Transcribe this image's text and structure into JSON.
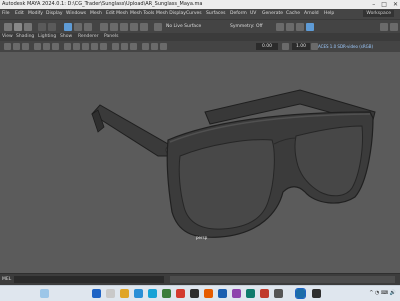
{
  "window": {
    "title": "Autodesk MAYA 2024.0.1: D:\\CG_Trader\\Sunglass\\Upload\\AR_Sunglass_Maya.ma",
    "controls": [
      "–",
      "□",
      "✕"
    ]
  },
  "menubar": {
    "items": [
      "File",
      "Edit",
      "Modify",
      "Display",
      "Windows",
      "Mesh",
      "Edit Mesh",
      "Mesh Tools",
      "Mesh Display",
      "Curves",
      "Surfaces",
      "Deform",
      "UV",
      "Generate",
      "Cache",
      "Arnold",
      "Help"
    ],
    "workspace": "Workspace"
  },
  "shelf": {
    "live_surface": "No Live Surface",
    "symmetry": "Symmetry: Off"
  },
  "panel_menu": {
    "items": [
      "View",
      "Shading",
      "Lighting",
      "Show",
      "Renderer",
      "Panels"
    ]
  },
  "panel_tools": {
    "field_a": "0.00",
    "field_b": "1.00",
    "aces": "ACES 1.0 SDR-video (sRGB)"
  },
  "viewport": {
    "camera_label": "persp",
    "object": "Sunglasses"
  },
  "command_line": {
    "mel_label": "MEL"
  },
  "colors": {
    "accent": "#5e9bd6",
    "viewport_bg": "#5b5b5b",
    "model_dark": "#3b3b3b"
  }
}
